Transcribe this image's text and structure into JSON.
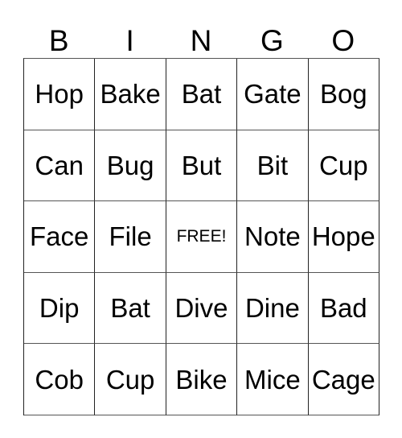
{
  "card": {
    "title": "BINGO",
    "header_letters": [
      "B",
      "I",
      "N",
      "G",
      "O"
    ],
    "free_space_label": "FREE!",
    "free_space_position": {
      "row": 3,
      "column": 3
    },
    "grid_size": "5x5",
    "colors": {
      "background": "#ffffff",
      "text": "#000000",
      "border": "#222222"
    },
    "rows": [
      {
        "cells": [
          {
            "text": "Hop",
            "free": false
          },
          {
            "text": "Bake",
            "free": false
          },
          {
            "text": "Bat",
            "free": false
          },
          {
            "text": "Gate",
            "free": false
          },
          {
            "text": "Bog",
            "free": false
          }
        ]
      },
      {
        "cells": [
          {
            "text": "Can",
            "free": false
          },
          {
            "text": "Bug",
            "free": false
          },
          {
            "text": "But",
            "free": false
          },
          {
            "text": "Bit",
            "free": false
          },
          {
            "text": "Cup",
            "free": false
          }
        ]
      },
      {
        "cells": [
          {
            "text": "Face",
            "free": false
          },
          {
            "text": "File",
            "free": false
          },
          {
            "text": "FREE!",
            "free": true
          },
          {
            "text": "Note",
            "free": false
          },
          {
            "text": "Hope",
            "free": false
          }
        ]
      },
      {
        "cells": [
          {
            "text": "Dip",
            "free": false
          },
          {
            "text": "Bat",
            "free": false
          },
          {
            "text": "Dive",
            "free": false
          },
          {
            "text": "Dine",
            "free": false
          },
          {
            "text": "Bad",
            "free": false
          }
        ]
      },
      {
        "cells": [
          {
            "text": "Cob",
            "free": false
          },
          {
            "text": "Cup",
            "free": false
          },
          {
            "text": "Bike",
            "free": false
          },
          {
            "text": "Mice",
            "free": false
          },
          {
            "text": "Cage",
            "free": false
          }
        ]
      }
    ]
  }
}
